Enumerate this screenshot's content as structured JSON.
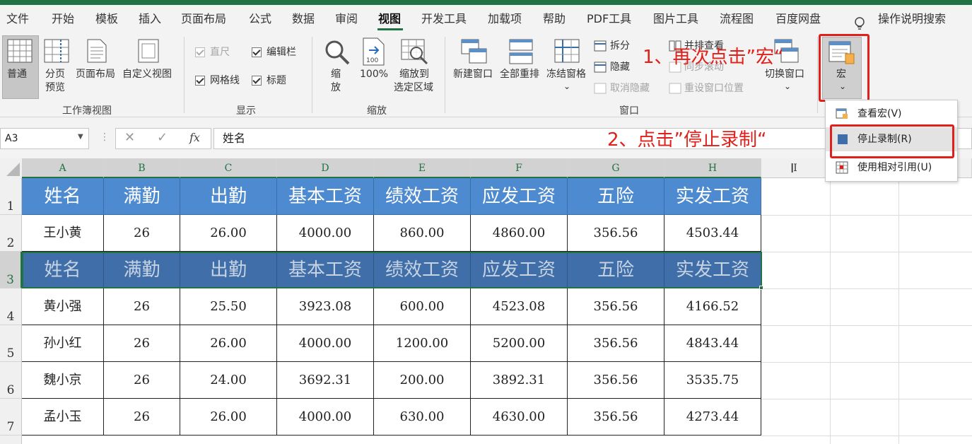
{
  "app": {
    "accent": "#217346",
    "annotation_color": "#e0201a"
  },
  "menu": {
    "items": [
      "文件",
      "开始",
      "模板",
      "插入",
      "页面布局",
      "公式",
      "数据",
      "审阅",
      "视图",
      "开发工具",
      "加载项",
      "帮助",
      "PDF工具",
      "图片工具",
      "流程图",
      "百度网盘"
    ],
    "active": "视图",
    "search_label": "操作说明搜索"
  },
  "ribbon": {
    "workbook_views": {
      "normal": "普通",
      "page_break_1": "分页",
      "page_break_2": "预览",
      "page_layout": "页面布局",
      "custom_views": "自定义视图",
      "group": "工作簿视图"
    },
    "show": {
      "ruler": "直尺",
      "formula_bar": "编辑栏",
      "gridlines": "网格线",
      "headings": "标题",
      "group": "显示"
    },
    "zoom": {
      "zoom_1": "缩",
      "zoom_2": "放",
      "zoom_100": "100%",
      "zoom_sel_1": "缩放到",
      "zoom_sel_2": "选定区域",
      "group": "缩放"
    },
    "window": {
      "new_window": "新建窗口",
      "arrange_all": "全部重排",
      "freeze_panes": "冻结窗格",
      "split": "拆分",
      "hide": "隐藏",
      "unhide": "取消隐藏",
      "side_by_side": "并排查看",
      "sync_scroll": "同步滚动",
      "reset_pos": "重设窗口位置",
      "switch": "切换窗口",
      "group": "窗口"
    },
    "macros": {
      "label": "宏"
    }
  },
  "annotations": {
    "step1": "1、再次点击”宏“",
    "step2": "2、点击”停止录制“"
  },
  "macro_menu": {
    "items": [
      {
        "label": "查看宏(V)"
      },
      {
        "label": "停止录制(R)"
      },
      {
        "label": "使用相对引用(U)"
      }
    ]
  },
  "formula_bar": {
    "name_box": "A3",
    "fx": "fx",
    "value": "姓名"
  },
  "sheet": {
    "columns": [
      "A",
      "B",
      "C",
      "D",
      "E",
      "F",
      "G",
      "H",
      "I"
    ],
    "rows": [
      "1",
      "2",
      "3",
      "4",
      "5",
      "6",
      "7"
    ],
    "header_row": [
      "姓名",
      "满勤",
      "出勤",
      "基本工资",
      "绩效工资",
      "应发工资",
      "五险",
      "实发工资"
    ],
    "data": [
      [
        "王小黄",
        "26",
        "26.00",
        "4000.00",
        "860.00",
        "4860.00",
        "356.56",
        "4503.44"
      ],
      [
        "黄小强",
        "26",
        "25.50",
        "3923.08",
        "600.00",
        "4523.08",
        "356.56",
        "4166.52"
      ],
      [
        "孙小红",
        "26",
        "26.00",
        "4000.00",
        "1200.00",
        "5200.00",
        "356.56",
        "4843.44"
      ],
      [
        "魏小京",
        "26",
        "24.00",
        "3692.31",
        "200.00",
        "3892.31",
        "356.56",
        "3535.75"
      ],
      [
        "孟小玉",
        "26",
        "26.00",
        "4000.00",
        "630.00",
        "4630.00",
        "356.56",
        "4273.44"
      ]
    ],
    "colors": {
      "header_fill": "#4e8ad0",
      "selected_header_fill": "#3f6ea9"
    }
  }
}
